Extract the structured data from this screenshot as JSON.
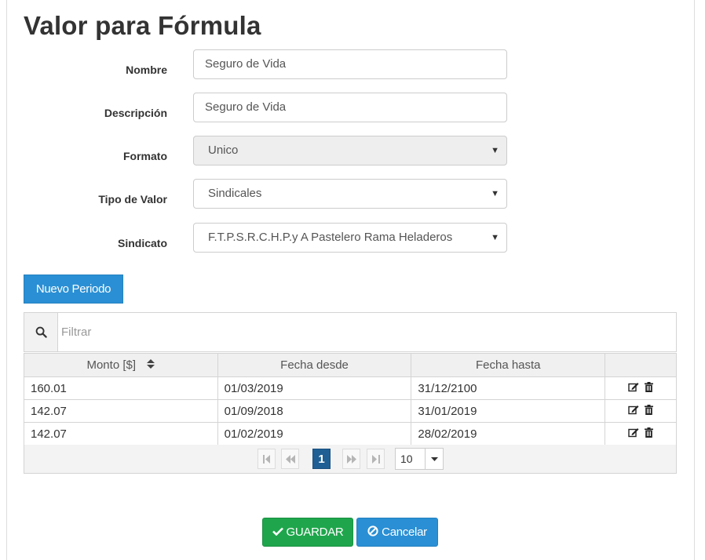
{
  "page": {
    "title": "Valor para Fórmula"
  },
  "form": {
    "nombre": {
      "label": "Nombre",
      "value": "Seguro de Vida"
    },
    "descripcion": {
      "label": "Descripción",
      "value": "Seguro de Vida"
    },
    "formato": {
      "label": "Formato",
      "value": "Unico",
      "disabled": true
    },
    "tipo_valor": {
      "label": "Tipo de Valor",
      "value": "Sindicales"
    },
    "sindicato": {
      "label": "Sindicato",
      "value": "F.T.P.S.R.C.H.P.y A Pastelero Rama Heladeros"
    }
  },
  "actions": {
    "new_period_label": "Nuevo Periodo",
    "save_label": "GUARDAR",
    "cancel_label": "Cancelar"
  },
  "filter": {
    "placeholder": "Filtrar",
    "icon": "search-icon"
  },
  "table": {
    "columns": [
      "Monto [$]",
      "Fecha desde",
      "Fecha hasta",
      ""
    ],
    "rows": [
      {
        "monto": "160.01",
        "desde": "01/03/2019",
        "hasta": "31/12/2100"
      },
      {
        "monto": "142.07",
        "desde": "01/09/2018",
        "hasta": "31/01/2019"
      },
      {
        "monto": "142.07",
        "desde": "01/02/2019",
        "hasta": "28/02/2019"
      }
    ]
  },
  "pager": {
    "current_page": "1",
    "page_size": "10"
  },
  "colors": {
    "primary": "#2a8fd4",
    "success": "#1fa64c",
    "active_page": "#1f5f94"
  }
}
